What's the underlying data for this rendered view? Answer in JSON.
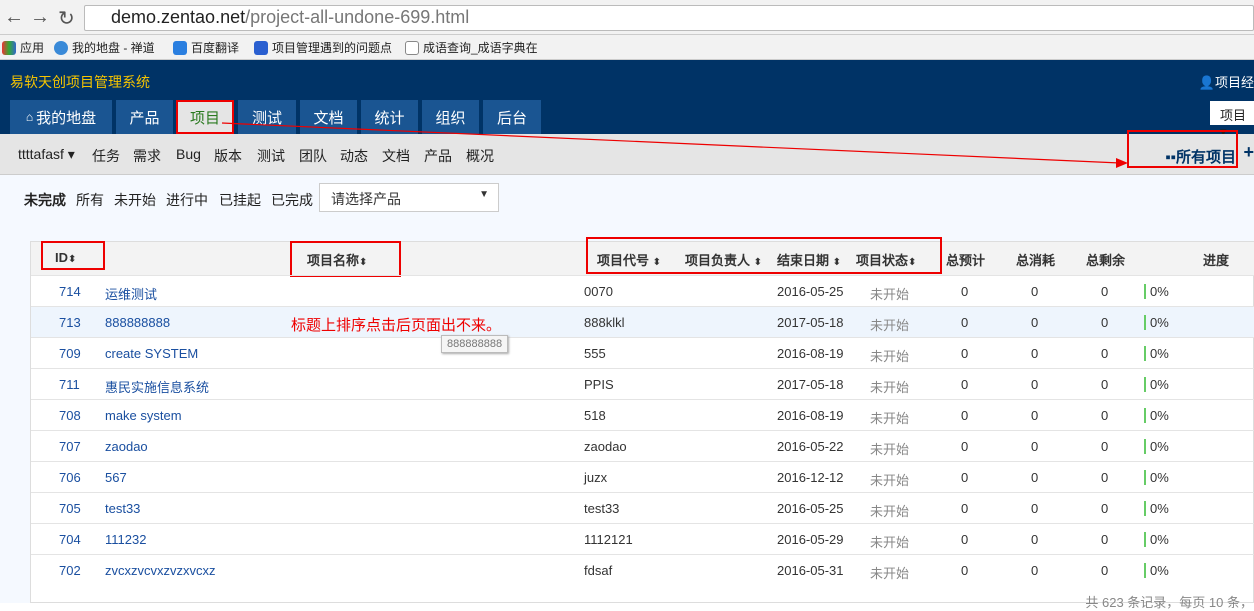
{
  "browser": {
    "url_host": "demo.zentao.net",
    "url_path": "/project-all-undone-699.html",
    "bookmarks": [
      "应用",
      "我的地盘 - 禅道",
      "百度翻译",
      "项目管理遇到的问题点",
      "成语查询_成语字典在"
    ]
  },
  "header": {
    "brand": "易软天创项目管理系统",
    "user": "项目经",
    "project_select": "项目",
    "nav": [
      "我的地盘",
      "产品",
      "项目",
      "测试",
      "文档",
      "统计",
      "组织",
      "后台"
    ]
  },
  "subnav": {
    "project": "ttttafasf",
    "items": [
      "任务",
      "需求",
      "Bug",
      "版本",
      "测试",
      "团队",
      "动态",
      "文档",
      "产品",
      "概况"
    ],
    "all_projects": "所有项目"
  },
  "filters": {
    "items": [
      "未完成",
      "所有",
      "未开始",
      "进行中",
      "已挂起",
      "已完成"
    ],
    "product_placeholder": "请选择产品"
  },
  "table": {
    "headers": {
      "id": "ID",
      "name": "项目名称",
      "code": "项目代号",
      "owner": "项目负责人",
      "end": "结束日期",
      "status": "项目状态",
      "estimate": "总预计",
      "consumed": "总消耗",
      "left": "总剩余",
      "progress": "进度"
    },
    "rows": [
      {
        "id": "714",
        "name": "运维测试",
        "code": "0070",
        "end": "2016-05-25",
        "status": "未开始",
        "estimate": "0",
        "consumed": "0",
        "left": "0",
        "progress": "0%"
      },
      {
        "id": "713",
        "name": "888888888",
        "code": "888klkl",
        "end": "2017-05-18",
        "status": "未开始",
        "estimate": "0",
        "consumed": "0",
        "left": "0",
        "progress": "0%"
      },
      {
        "id": "709",
        "name": "create SYSTEM",
        "code": "555",
        "end": "2016-08-19",
        "status": "未开始",
        "estimate": "0",
        "consumed": "0",
        "left": "0",
        "progress": "0%"
      },
      {
        "id": "711",
        "name": "惠民实施信息系统",
        "code": "PPIS",
        "end": "2017-05-18",
        "status": "未开始",
        "estimate": "0",
        "consumed": "0",
        "left": "0",
        "progress": "0%"
      },
      {
        "id": "708",
        "name": "make system",
        "code": "518",
        "end": "2016-08-19",
        "status": "未开始",
        "estimate": "0",
        "consumed": "0",
        "left": "0",
        "progress": "0%"
      },
      {
        "id": "707",
        "name": "zaodao",
        "code": "zaodao",
        "end": "2016-05-22",
        "status": "未开始",
        "estimate": "0",
        "consumed": "0",
        "left": "0",
        "progress": "0%"
      },
      {
        "id": "706",
        "name": "567",
        "code": "juzx",
        "end": "2016-12-12",
        "status": "未开始",
        "estimate": "0",
        "consumed": "0",
        "left": "0",
        "progress": "0%"
      },
      {
        "id": "705",
        "name": "test33",
        "code": "test33",
        "end": "2016-05-25",
        "status": "未开始",
        "estimate": "0",
        "consumed": "0",
        "left": "0",
        "progress": "0%"
      },
      {
        "id": "704",
        "name": "111232",
        "code": "1112121",
        "end": "2016-05-29",
        "status": "未开始",
        "estimate": "0",
        "consumed": "0",
        "left": "0",
        "progress": "0%"
      },
      {
        "id": "702",
        "name": "zvcxzvcvxzvzxvcxz",
        "code": "fdsaf",
        "end": "2016-05-31",
        "status": "未开始",
        "estimate": "0",
        "consumed": "0",
        "left": "0",
        "progress": "0%"
      }
    ],
    "footer": "共 623 条记录，每页 10 条，"
  },
  "annotation": {
    "note": "标题上排序点击后页面出不来。",
    "tooltip": "888888888"
  }
}
